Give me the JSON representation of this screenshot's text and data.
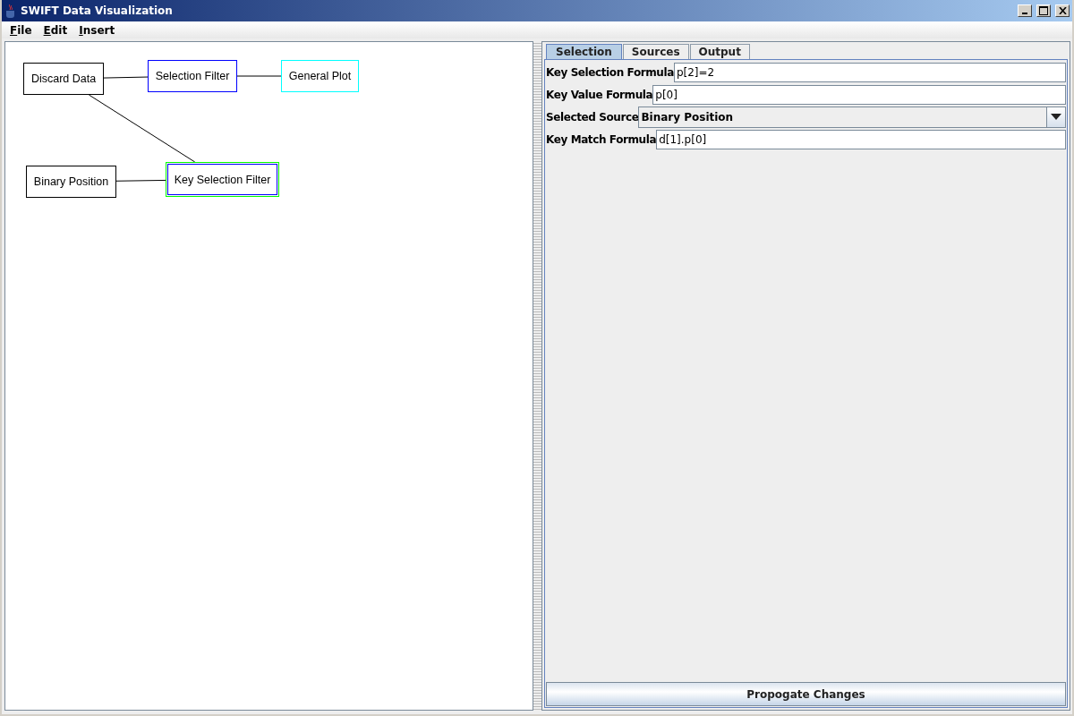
{
  "window": {
    "title": "SWIFT Data Visualization"
  },
  "menu": [
    "File",
    "Edit",
    "Insert"
  ],
  "diagram": {
    "nodes": [
      {
        "label": "Discard Data",
        "color": "#000000",
        "selected": false
      },
      {
        "label": "Selection Filter",
        "color": "#0000ff",
        "selected": false
      },
      {
        "label": "General Plot",
        "color": "#00ffff",
        "selected": false
      },
      {
        "label": "Binary Position",
        "color": "#000000",
        "selected": false
      },
      {
        "label": "Key Selection Filter",
        "color": "#0000ff",
        "selected": true
      }
    ]
  },
  "tabs": [
    {
      "label": "Selection",
      "selected": true
    },
    {
      "label": "Sources",
      "selected": false
    },
    {
      "label": "Output",
      "selected": false
    }
  ],
  "form": [
    {
      "kind": "text",
      "label": "Key Selection Formula",
      "value": "p[2]=2"
    },
    {
      "kind": "text",
      "label": "Key Value Formula",
      "value": "p[0]"
    },
    {
      "kind": "select",
      "label": "Selected Source",
      "value": "Binary Position"
    },
    {
      "kind": "text",
      "label": "Key Match Formula",
      "value": "d[1].p[0]"
    }
  ],
  "button": "Propogate Changes"
}
